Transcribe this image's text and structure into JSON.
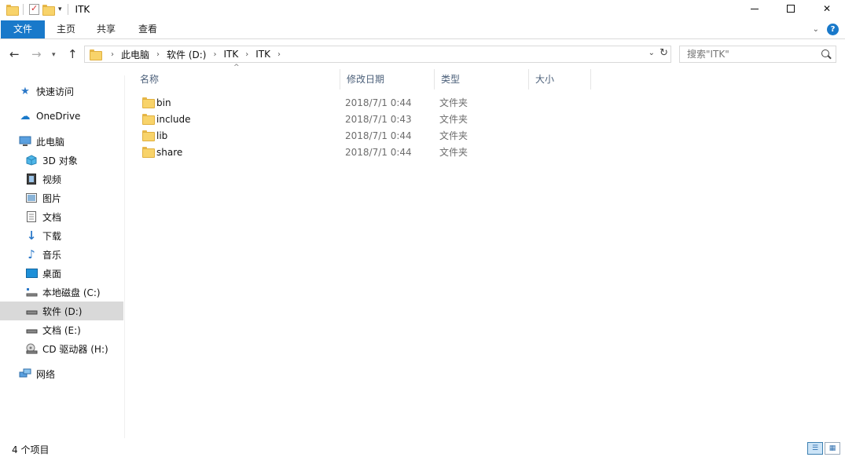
{
  "window": {
    "title": "ITK",
    "minimize_glyph": "—",
    "close_glyph": "✕"
  },
  "ribbon": {
    "tabs": [
      "文件",
      "主页",
      "共享",
      "查看"
    ]
  },
  "address": {
    "crumbs": [
      "此电脑",
      "软件 (D:)",
      "ITK",
      "ITK"
    ]
  },
  "search": {
    "placeholder": "搜索\"ITK\""
  },
  "sidebar": {
    "items": [
      {
        "label": "快速访问",
        "icon": "star-icon"
      },
      {
        "label": "OneDrive",
        "icon": "cloud-icon"
      },
      {
        "label": "此电脑",
        "icon": "computer-icon"
      },
      {
        "label": "3D 对象",
        "icon": "cube-icon"
      },
      {
        "label": "视频",
        "icon": "video-icon"
      },
      {
        "label": "图片",
        "icon": "picture-icon"
      },
      {
        "label": "文档",
        "icon": "document-icon"
      },
      {
        "label": "下载",
        "icon": "download-icon"
      },
      {
        "label": "音乐",
        "icon": "music-icon"
      },
      {
        "label": "桌面",
        "icon": "desktop-icon"
      },
      {
        "label": "本地磁盘 (C:)",
        "icon": "windows-drive-icon"
      },
      {
        "label": "软件 (D:)",
        "icon": "drive-icon",
        "selected": true
      },
      {
        "label": "文档 (E:)",
        "icon": "drive-icon"
      },
      {
        "label": "CD 驱动器 (H:)",
        "icon": "cd-drive-icon"
      },
      {
        "label": "网络",
        "icon": "network-icon"
      }
    ]
  },
  "columns": {
    "name": "名称",
    "modified": "修改日期",
    "type": "类型",
    "size": "大小"
  },
  "files": [
    {
      "name": "bin",
      "modified": "2018/7/1 0:44",
      "type": "文件夹"
    },
    {
      "name": "include",
      "modified": "2018/7/1 0:43",
      "type": "文件夹"
    },
    {
      "name": "lib",
      "modified": "2018/7/1 0:44",
      "type": "文件夹"
    },
    {
      "name": "share",
      "modified": "2018/7/1 0:44",
      "type": "文件夹"
    }
  ],
  "status": {
    "item_count": "4 个项目"
  },
  "colors": {
    "accent": "#1979ca",
    "selected_bg": "#d9d9d9",
    "header_text": "#4c607a"
  }
}
